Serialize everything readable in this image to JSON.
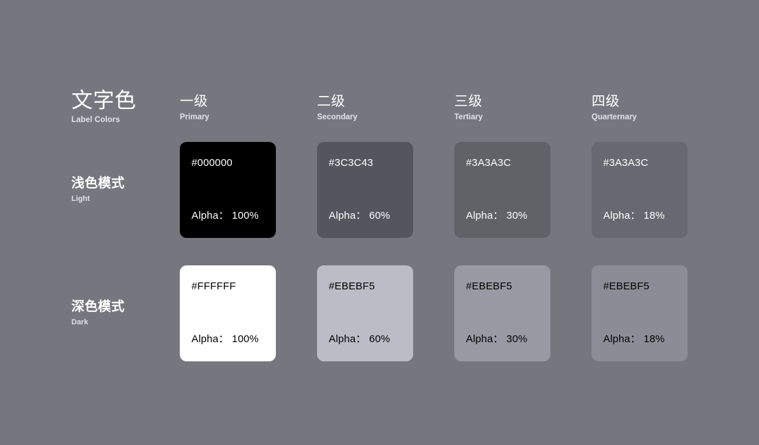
{
  "page": {
    "background_color": "#76767F"
  },
  "header": {
    "title_zh": "文字色",
    "title_en": "Label Colors"
  },
  "columns": [
    {
      "zh": "一级",
      "en": "Primary"
    },
    {
      "zh": "二级",
      "en": "Secondary"
    },
    {
      "zh": "三级",
      "en": "Tertiary"
    },
    {
      "zh": "四级",
      "en": "Quarternary"
    }
  ],
  "rows": [
    {
      "zh": "浅色模式",
      "en": "Light",
      "swatches": [
        {
          "hex": "#000000",
          "alpha": "Alpha： 100%",
          "fill": "#000000",
          "text_on": "dark"
        },
        {
          "hex": "#3C3C43",
          "alpha": "Alpha： 60%",
          "fill": "#55555E",
          "text_on": "dark"
        },
        {
          "hex": "#3A3A3C",
          "alpha": "Alpha： 30%",
          "fill": "#616168",
          "text_on": "dark"
        },
        {
          "hex": "#3A3A3C",
          "alpha": "Alpha： 18%",
          "fill": "#686870",
          "text_on": "dark"
        }
      ]
    },
    {
      "zh": "深色模式",
      "en": "Dark",
      "swatches": [
        {
          "hex": "#FFFFFF",
          "alpha": "Alpha： 100%",
          "fill": "#FFFFFF",
          "text_on": "light"
        },
        {
          "hex": "#EBEBF5",
          "alpha": "Alpha： 60%",
          "fill": "#BCBCC6",
          "text_on": "light"
        },
        {
          "hex": "#EBEBF5",
          "alpha": "Alpha： 30%",
          "fill": "#9999A3",
          "text_on": "light"
        },
        {
          "hex": "#EBEBF5",
          "alpha": "Alpha： 18%",
          "fill": "#8C8C96",
          "text_on": "light"
        }
      ]
    }
  ]
}
